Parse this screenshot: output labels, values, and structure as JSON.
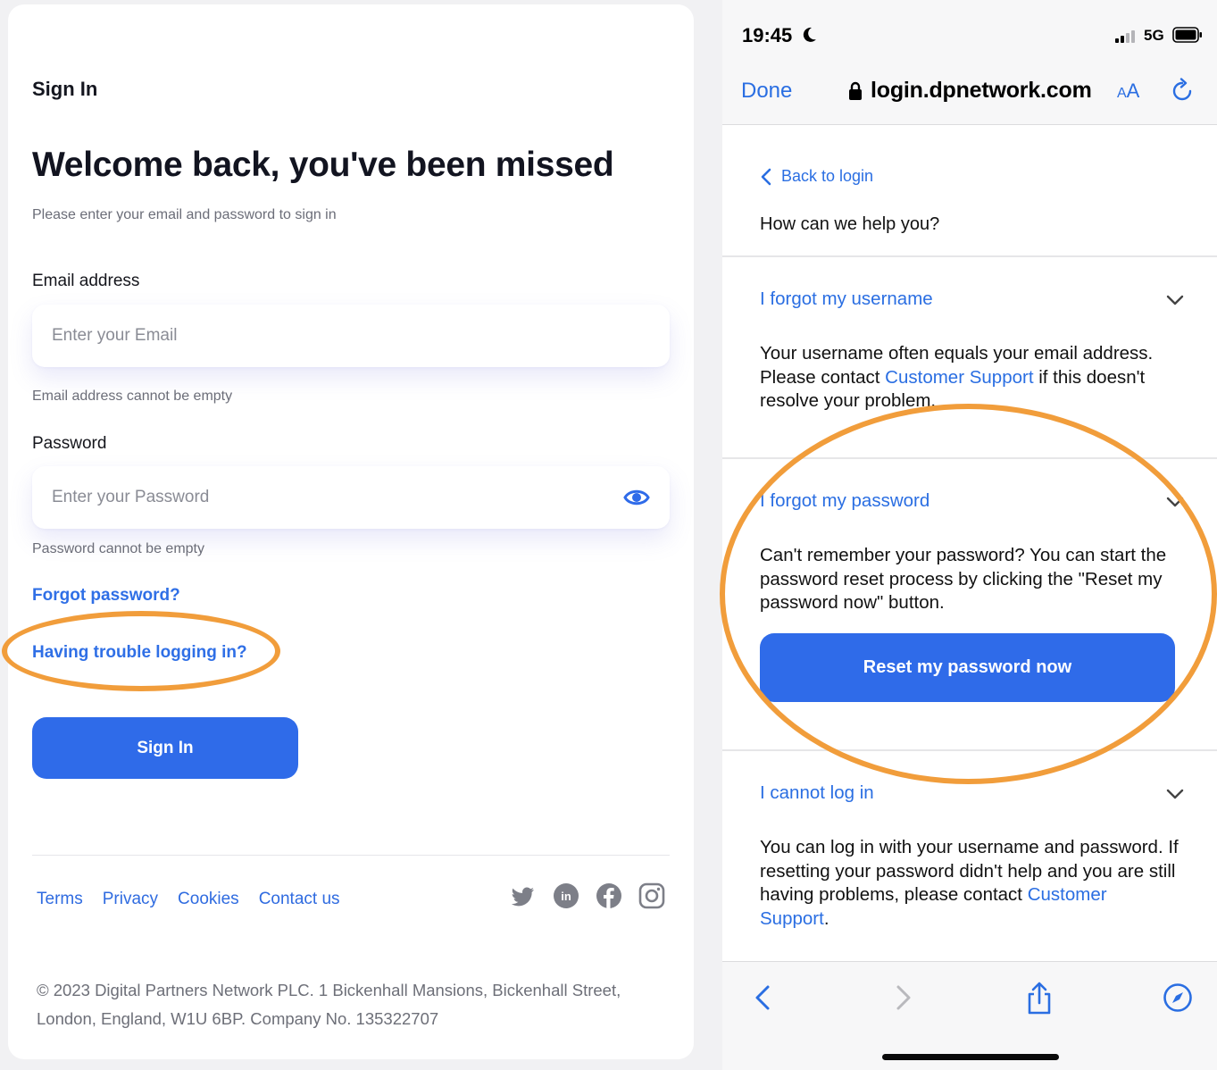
{
  "left": {
    "signin_heading": "Sign In",
    "welcome_title": "Welcome back, you've been missed",
    "welcome_subtitle": "Please enter your email and password to sign in",
    "email": {
      "label": "Email address",
      "placeholder": "Enter your Email",
      "value": "",
      "error": "Email address cannot be empty"
    },
    "password": {
      "label": "Password",
      "placeholder": "Enter your Password",
      "value": "",
      "error": "Password cannot be empty",
      "toggle_icon": "eye-icon"
    },
    "forgot_password_link": "Forgot password?",
    "trouble_link": "Having trouble logging in?",
    "signin_button": "Sign In",
    "footer_links": [
      "Terms",
      "Privacy",
      "Cookies",
      "Contact us"
    ],
    "social_icons": [
      "twitter-icon",
      "linkedin-icon",
      "facebook-icon",
      "instagram-icon"
    ],
    "copyright": "© 2023 Digital Partners Network PLC. 1 Bickenhall Mansions, Bickenhall Street, London, England, W1U 6BP. Company No. 135322707"
  },
  "phone": {
    "status": {
      "time": "19:45",
      "network": "5G"
    },
    "browser": {
      "done_label": "Done",
      "url": "login.dpnetwork.com",
      "aa_small": "A",
      "aa_large": "A"
    },
    "back_link": "Back to login",
    "help_question": "How can we help you?",
    "sections": [
      {
        "title": "I forgot my username",
        "body_before": "Your username often equals your email address. Please contact ",
        "body_link": "Customer Support",
        "body_after": " if this doesn't resolve your problem."
      },
      {
        "title": "I forgot my password",
        "body": "Can't remember your password? You can start the password reset process by clicking the \"Reset my password now\" button.",
        "button": "Reset my password now"
      },
      {
        "title": "I cannot log in",
        "body_before": "You can log in with your username and password. If resetting your password didn't help and you are still having problems, please contact ",
        "body_link": "Customer Support",
        "body_after": "."
      }
    ],
    "toolbar_icons": [
      "back-arrow-icon",
      "forward-arrow-icon",
      "share-icon",
      "compass-icon"
    ]
  },
  "colors": {
    "accent": "#2f6be9",
    "link": "#2a6ee2",
    "annotation": "#f19d3b",
    "title_text": "#121420",
    "muted_text": "#6b6d78"
  }
}
